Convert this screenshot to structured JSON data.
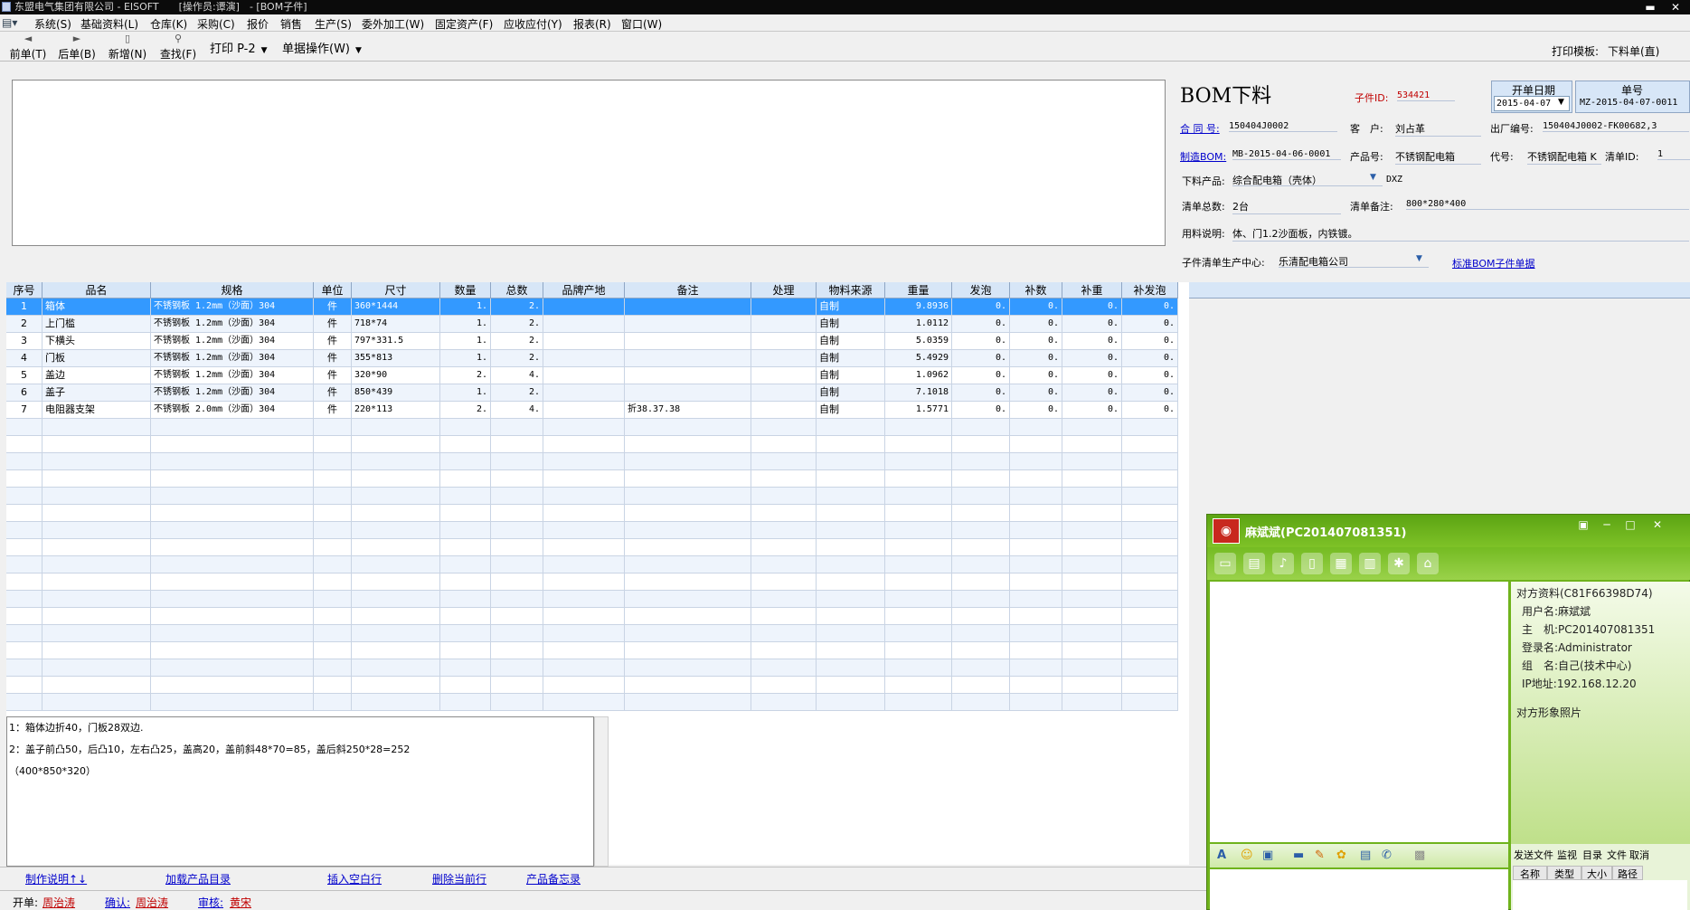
{
  "window": {
    "title": "东盟电气集团有限公司 - EISOFT　　[操作员:谭演]　- [BOM子件]",
    "minimize": "▬",
    "restore": "❐",
    "close": "✕"
  },
  "menu": [
    "系统(S)",
    "基础资料(L)",
    "仓库(K)",
    "采购(C)",
    "报价",
    "销售",
    "生产(S)",
    "委外加工(W)",
    "固定资产(F)",
    "应收应付(Y)",
    "报表(R)",
    "窗口(W)"
  ],
  "toolbar": {
    "prev": "前单(T)",
    "next": "后单(B)",
    "new": "新增(N)",
    "find": "查找(F)",
    "print": "打印 P-2",
    "ops": "单据操作(W)",
    "template_label": "打印模板:",
    "template_value": "下料单(直)"
  },
  "header": {
    "title": "BOM下料",
    "child_id_label": "子件ID:",
    "child_id": "534421",
    "open_date_label": "开单日期",
    "open_date": "2015-04-07",
    "order_no_label": "单号",
    "order_no": "MZ-2015-04-07-0011",
    "contract_label": "合 同 号:",
    "contract": "150404J0002",
    "customer_label": "客　户:",
    "customer": "刘占革",
    "factory_no_label": "出厂编号:",
    "factory_no": "150404J0002-FK00682,3",
    "bom_label": "制造BOM:",
    "bom": "MB-2015-04-06-0001",
    "product_no_label": "产品号:",
    "product_no": "不锈钢配电箱",
    "code_label": "代号:",
    "code": "不锈钢配电箱 K",
    "list_id_label": "清单ID:",
    "list_id": "1",
    "cut_product_label": "下料产品:",
    "cut_product": "综合配电箱（壳体）",
    "cut_product_code": "DXZ",
    "total_label": "清单总数:",
    "total": "2台",
    "remark_label": "清单备注:",
    "remark": "800*280*400",
    "usage_label": "用料说明:",
    "usage": "体、门1.2沙面板，内铁镀。",
    "center_label": "子件清单生产中心:",
    "center": "乐清配电箱公司",
    "std_link": "标准BOM子件单据"
  },
  "grid": {
    "columns": [
      "序号",
      "品名",
      "规格",
      "单位",
      "尺寸",
      "数量",
      "总数",
      "品牌产地",
      "备注",
      "处理",
      "物料来源",
      "重量",
      "发泡",
      "补数",
      "补重",
      "补发泡"
    ],
    "rows": [
      {
        "no": "1",
        "name": "箱体",
        "spec": "不锈钢板 1.2mm（沙面）304",
        "unit": "件",
        "size": "360*1444",
        "qty": "1.",
        "total": "2.",
        "brand": "",
        "note": "",
        "proc": "",
        "src": "自制",
        "weight": "9.8936",
        "foam": "0.",
        "addq": "0.",
        "addw": "0.",
        "addf": "0."
      },
      {
        "no": "2",
        "name": "上门槛",
        "spec": "不锈钢板 1.2mm（沙面）304",
        "unit": "件",
        "size": "718*74",
        "qty": "1.",
        "total": "2.",
        "brand": "",
        "note": "",
        "proc": "",
        "src": "自制",
        "weight": "1.0112",
        "foam": "0.",
        "addq": "0.",
        "addw": "0.",
        "addf": "0."
      },
      {
        "no": "3",
        "name": "下横头",
        "spec": "不锈钢板 1.2mm（沙面）304",
        "unit": "件",
        "size": "797*331.5",
        "qty": "1.",
        "total": "2.",
        "brand": "",
        "note": "",
        "proc": "",
        "src": "自制",
        "weight": "5.0359",
        "foam": "0.",
        "addq": "0.",
        "addw": "0.",
        "addf": "0."
      },
      {
        "no": "4",
        "name": "门板",
        "spec": "不锈钢板 1.2mm（沙面）304",
        "unit": "件",
        "size": "355*813",
        "qty": "1.",
        "total": "2.",
        "brand": "",
        "note": "",
        "proc": "",
        "src": "自制",
        "weight": "5.4929",
        "foam": "0.",
        "addq": "0.",
        "addw": "0.",
        "addf": "0."
      },
      {
        "no": "5",
        "name": "盖边",
        "spec": "不锈钢板 1.2mm（沙面）304",
        "unit": "件",
        "size": "320*90",
        "qty": "2.",
        "total": "4.",
        "brand": "",
        "note": "",
        "proc": "",
        "src": "自制",
        "weight": "1.0962",
        "foam": "0.",
        "addq": "0.",
        "addw": "0.",
        "addf": "0."
      },
      {
        "no": "6",
        "name": "盖子",
        "spec": "不锈钢板 1.2mm（沙面）304",
        "unit": "件",
        "size": "850*439",
        "qty": "1.",
        "total": "2.",
        "brand": "",
        "note": "",
        "proc": "",
        "src": "自制",
        "weight": "7.1018",
        "foam": "0.",
        "addq": "0.",
        "addw": "0.",
        "addf": "0."
      },
      {
        "no": "7",
        "name": "电阻器支架",
        "spec": "不锈钢板 2.0mm（沙面）304",
        "unit": "件",
        "size": "220*113",
        "qty": "2.",
        "total": "4.",
        "brand": "",
        "note": "折38.37.38",
        "proc": "",
        "src": "自制",
        "weight": "1.5771",
        "foam": "0.",
        "addq": "0.",
        "addw": "0.",
        "addf": "0."
      }
    ]
  },
  "notes": [
    "1：箱体边折40，门板28双边.",
    "2：盖子前凸50，后凸10，左右凸25，盖高20，盖前斜48*70=85，盖后斜250*28=252",
    "（400*850*320）"
  ],
  "links": [
    "制作说明↑↓",
    "加载产品目录",
    "插入空白行",
    "删除当前行",
    "产品备忘录"
  ],
  "status": {
    "open_label": "开单:",
    "open_user": "周治涛",
    "confirm_label": "确认:",
    "confirm_user": "周治涛",
    "audit_label": "审核:",
    "audit_user": "黄宋"
  },
  "chat": {
    "title": "麻斌斌(PC201407081351)",
    "info_title": "对方资料(C81F66398D74)",
    "username": "用户名:麻斌斌",
    "host": "主　机:PC201407081351",
    "login": "登录名:Administrator",
    "group": "组　名:自己(技术中心)",
    "ip": "IP地址:192.168.12.20",
    "photo": "对方形象照片",
    "file_send": "发送文件",
    "monitor": "监视",
    "dir": "目录",
    "file": "文件",
    "cancel": "取消",
    "col_name": "名称",
    "col_type": "类型",
    "col_size": "大小",
    "col_path": "路径"
  }
}
